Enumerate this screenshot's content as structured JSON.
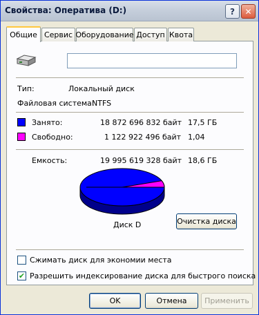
{
  "window": {
    "title": "Свойства: Оперативa (D:)",
    "help_glyph": "?",
    "close_glyph": "✕"
  },
  "tabs": [
    {
      "label": "Общие",
      "active": true
    },
    {
      "label": "Сервис"
    },
    {
      "label": "Оборудование"
    },
    {
      "label": "Доступ"
    },
    {
      "label": "Квота"
    }
  ],
  "general": {
    "drive_icon": "hard-drive-icon",
    "volume_label_value": "",
    "type_label": "Тип:",
    "type_value": "Локальный диск",
    "fs_label": "Файловая система:",
    "fs_value": "NTFS",
    "used_label": "Занято:",
    "used_bytes": "18 872 696 832 байт",
    "used_size": "17,5 ГБ",
    "free_label": "Свободно:",
    "free_bytes": "1 122 922 496 байт",
    "free_size": "1,04",
    "capacity_label": "Емкость:",
    "capacity_bytes": "19 995 619 328 байт",
    "capacity_size": "18,6 ГБ",
    "disk_name": "Диск D",
    "cleanup_button": "Очистка диска",
    "compress_label": "Сжимать диск для экономии места",
    "compress_checked": false,
    "index_label": "Разрешить индексирование диска для быстрого поиска",
    "index_checked": true,
    "check_glyph": "✔"
  },
  "colors": {
    "used": "#0000ff",
    "free": "#ff00ff"
  },
  "chart_data": {
    "type": "pie",
    "categories": [
      "Занято",
      "Свободно"
    ],
    "values": [
      18872696832,
      1122922496
    ]
  },
  "footer": {
    "ok": "OK",
    "cancel": "Отмена",
    "apply": "Применить"
  }
}
